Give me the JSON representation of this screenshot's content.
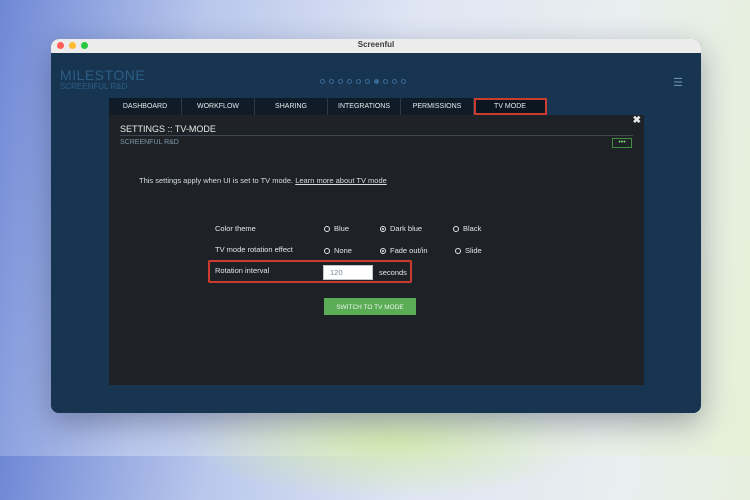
{
  "window": {
    "title": "Screenful"
  },
  "brand": {
    "name": "MILESTONE",
    "subtitle": "SCREENFUL R&D"
  },
  "pager": {
    "count": 10,
    "active_index": 6
  },
  "tabs": [
    {
      "label": "DASHBOARD"
    },
    {
      "label": "WORKFLOW"
    },
    {
      "label": "SHARING"
    },
    {
      "label": "INTEGRATIONS"
    },
    {
      "label": "PERMISSIONS"
    },
    {
      "label": "TV MODE",
      "active": true
    }
  ],
  "panel": {
    "title": "SETTINGS :: TV-MODE",
    "subtitle": "SCREENFUL R&D",
    "more_label": "•••",
    "close_label": "✖",
    "info_text": "This settings apply when UI is set to TV mode.",
    "info_link": "Learn more about TV mode"
  },
  "settings": {
    "color_theme": {
      "label": "Color theme",
      "options": [
        "Blue",
        "Dark blue",
        "Black"
      ],
      "selected": "Dark blue"
    },
    "rotation_effect": {
      "label": "TV mode rotation effect",
      "options": [
        "None",
        "Fade out/in",
        "Slide"
      ],
      "selected": "Fade out/in"
    },
    "rotation_interval": {
      "label": "Rotation interval",
      "value": "120",
      "unit": "seconds"
    }
  },
  "switch_button": {
    "label": "SWITCH TO TV MODE"
  },
  "colors": {
    "accent_red": "#cc3b2f",
    "button_green": "#5aac55",
    "app_bg": "#173451"
  }
}
